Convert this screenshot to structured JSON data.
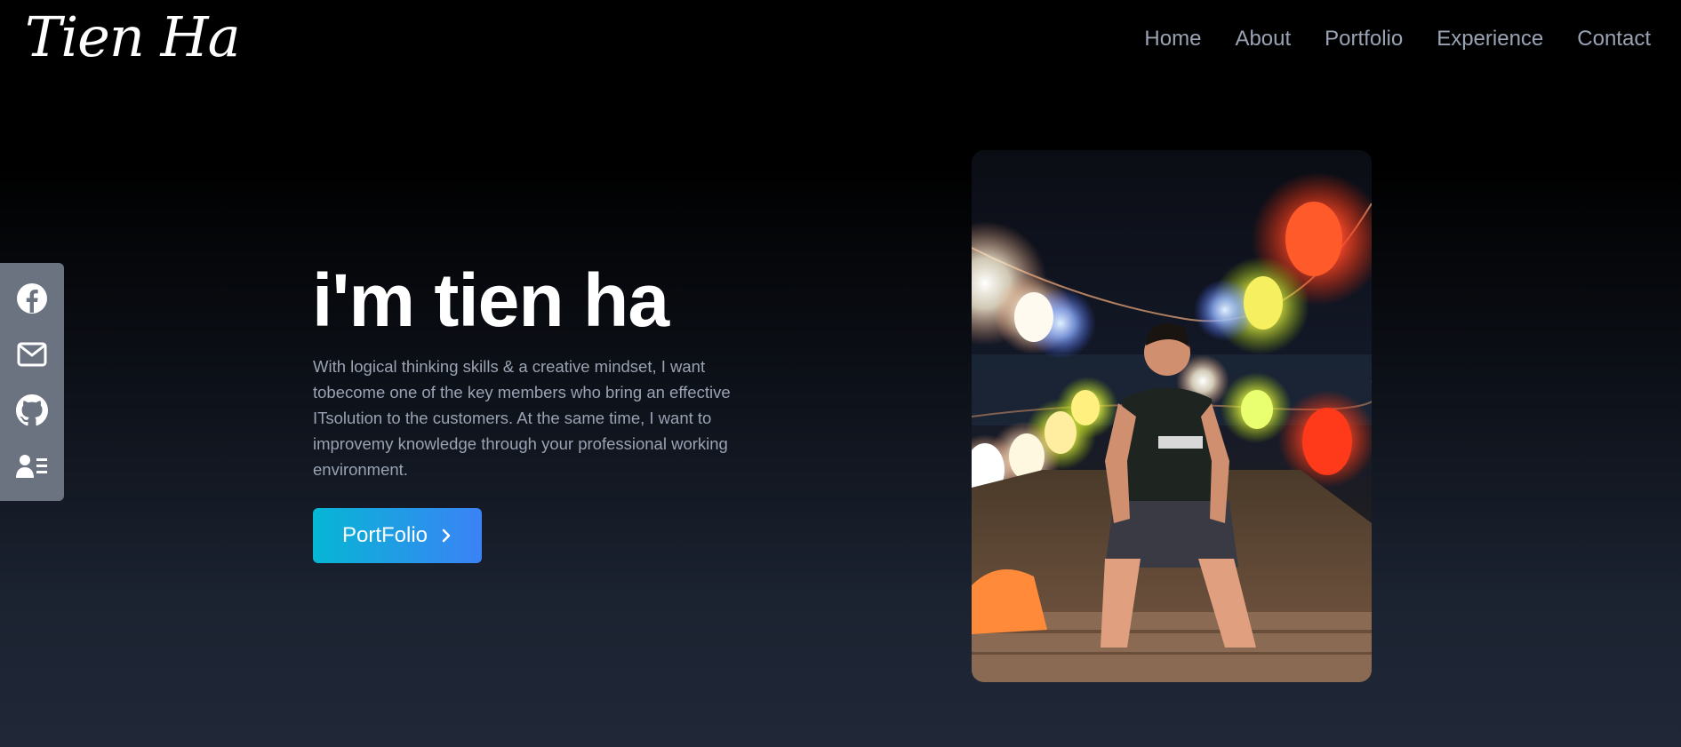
{
  "header": {
    "logo": "Tien Ha",
    "nav": [
      "Home",
      "About",
      "Portfolio",
      "Experience",
      "Contact"
    ]
  },
  "social": {
    "icons": [
      "facebook-icon",
      "mail-icon",
      "github-icon",
      "resume-icon"
    ]
  },
  "hero": {
    "title": "i'm tien ha",
    "description": "With logical thinking skills & a creative mindset, I want tobecome one of the key members who bring an effective ITsolution to the customers. At the same time, I want to improvemy knowledge through your professional working environment.",
    "cta_label": "PortFolio"
  },
  "colors": {
    "accent_start": "#06b6d4",
    "accent_end": "#3b82f6",
    "nav_text": "#9aa3b3",
    "sidebar_bg": "#6b7280"
  }
}
